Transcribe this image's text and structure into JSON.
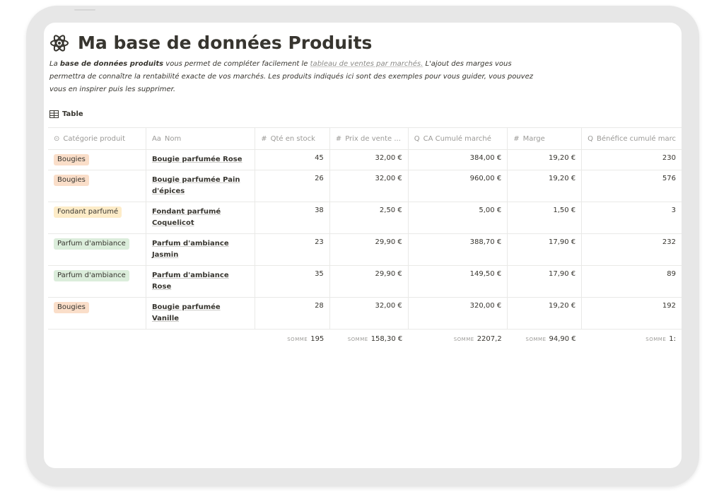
{
  "page": {
    "title": "Ma base de données Produits",
    "icon": "atom-icon",
    "description": {
      "p1": "La ",
      "bold": "base de données produits",
      "p2": " vous permet de compléter facilement le ",
      "link": "tableau de ventes par marchés.",
      "p3": " L'ajout des marges vous permettra de connaître la rentabilité exacte de vos marchés. Les produits indiqués ici sont des exemples pour vous guider, vous pouvez vous en inspirer puis les supprimer."
    }
  },
  "view": {
    "label": "Table",
    "icon": "table-icon"
  },
  "columns": [
    {
      "label": "Catégorie produit",
      "icon_glyph": "⊙"
    },
    {
      "label": "Nom",
      "icon_glyph": "Aa"
    },
    {
      "label": "Qté en stock",
      "icon_glyph": "#"
    },
    {
      "label": "Prix de vente ...",
      "icon_glyph": "#"
    },
    {
      "label": "CA Cumulé marché",
      "icon_glyph": "Q"
    },
    {
      "label": "Marge",
      "icon_glyph": "#"
    },
    {
      "label": "Bénéfice cumulé marc",
      "icon_glyph": "Q"
    }
  ],
  "rows": [
    {
      "cat": "Bougies",
      "cat_color": "#fadec9",
      "nom": "Bougie parfumée Rose",
      "qte": "45",
      "prix": "32,00 €",
      "ca": "384,00 €",
      "marge": "19,20 €",
      "benef": "230"
    },
    {
      "cat": "Bougies",
      "cat_color": "#fadec9",
      "nom": "Bougie parfumée Pain d'épices",
      "qte": "26",
      "prix": "32,00 €",
      "ca": "960,00 €",
      "marge": "19,20 €",
      "benef": "576"
    },
    {
      "cat": "Fondant parfumé",
      "cat_color": "#fdecc8",
      "nom": "Fondant parfumé Coquelicot",
      "qte": "38",
      "prix": "2,50 €",
      "ca": "5,00 €",
      "marge": "1,50 €",
      "benef": "3"
    },
    {
      "cat": "Parfum d'ambiance",
      "cat_color": "#dbeddb",
      "nom": "Parfum d'ambiance Jasmin",
      "qte": "23",
      "prix": "29,90 €",
      "ca": "388,70 €",
      "marge": "17,90 €",
      "benef": "232"
    },
    {
      "cat": "Parfum d'ambiance",
      "cat_color": "#dbeddb",
      "nom": "Parfum d'ambiance Rose",
      "qte": "35",
      "prix": "29,90 €",
      "ca": "149,50 €",
      "marge": "17,90 €",
      "benef": "89"
    },
    {
      "cat": "Bougies",
      "cat_color": "#fadec9",
      "nom": "Bougie parfumée Vanille",
      "qte": "28",
      "prix": "32,00 €",
      "ca": "320,00 €",
      "marge": "19,20 €",
      "benef": "192"
    }
  ],
  "sums": {
    "label": "SOMME",
    "qte": "195",
    "prix": "158,30 €",
    "ca": "2207,2",
    "marge": "94,90 €",
    "benef": "1:"
  },
  "colors": {
    "text": "#37352f",
    "muted": "#9b9a97",
    "border": "#e9e9e7"
  }
}
